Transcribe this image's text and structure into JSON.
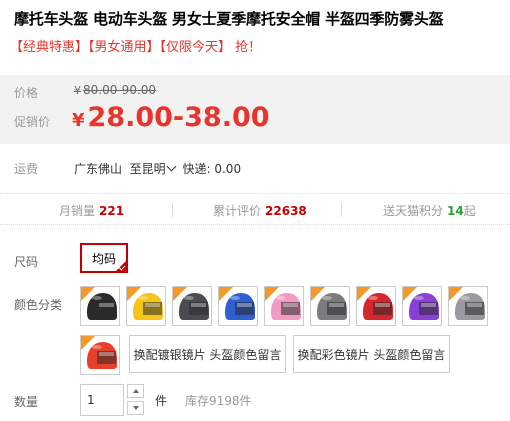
{
  "product": {
    "title": "摩托车头盔 电动车头盔 男女士夏季摩托安全帽 半盔四季防雾头盔",
    "promo_tags": "【经典特惠】【男女通用】【仅限今天】 抢！"
  },
  "price": {
    "label": "价格",
    "currency": "¥",
    "original": "80.00-90.00",
    "promo_label": "促销价",
    "promo": "28.00-38.00"
  },
  "shipping": {
    "label": "运费",
    "from": "广东佛山",
    "to": "至昆明",
    "express": "快递: 0.00"
  },
  "stats": {
    "monthly_sales_label": "月销量",
    "monthly_sales": "221",
    "reviews_label": "累计评价",
    "reviews": "22638",
    "points_label": "送天猫积分",
    "points": "14",
    "points_suffix": "起"
  },
  "options": {
    "size_label": "尺码",
    "size_selected": "均码",
    "color_label": "颜色分类",
    "color_swatches": [
      {
        "name": "black",
        "color": "#2b2b2b"
      },
      {
        "name": "yellow",
        "color": "#f5c518"
      },
      {
        "name": "gray-dark",
        "color": "#4a4c52"
      },
      {
        "name": "blue",
        "color": "#2f5fd3"
      },
      {
        "name": "pink",
        "color": "#f29bc2"
      },
      {
        "name": "gray",
        "color": "#7b7b80"
      },
      {
        "name": "red",
        "color": "#d8262e"
      },
      {
        "name": "purple",
        "color": "#8a3fd6"
      },
      {
        "name": "silver",
        "color": "#9a9a9e"
      },
      {
        "name": "red-orange",
        "color": "#e8402a"
      }
    ],
    "text_option_1": "换配镀银镜片 头盔颜色留言",
    "text_option_2": "换配彩色镜片 头盔颜色留言"
  },
  "quantity": {
    "label": "数量",
    "value": "1",
    "unit": "件",
    "stock": "库存9198件"
  }
}
